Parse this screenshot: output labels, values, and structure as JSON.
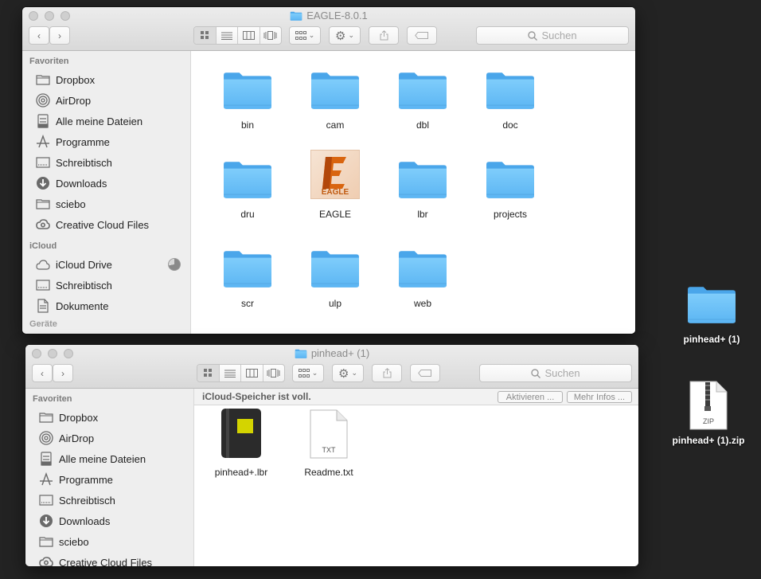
{
  "window1": {
    "title": "EAGLE-8.0.1",
    "search_placeholder": "Suchen",
    "sidebar": {
      "favorites_header": "Favoriten",
      "favorites": [
        "Dropbox",
        "AirDrop",
        "Alle meine Dateien",
        "Programme",
        "Schreibtisch",
        "Downloads",
        "sciebo",
        "Creative Cloud Files"
      ],
      "icloud_header": "iCloud",
      "icloud": [
        "iCloud Drive",
        "Schreibtisch",
        "Dokumente"
      ],
      "devices_header": "Geräte"
    },
    "items": [
      "bin",
      "cam",
      "dbl",
      "doc",
      "dru",
      "EAGLE",
      "lbr",
      "projects",
      "scr",
      "ulp",
      "web"
    ],
    "app_icon_text": "EAGLE"
  },
  "window2": {
    "title": "pinhead+ (1)",
    "search_placeholder": "Suchen",
    "banner": {
      "text": "iCloud-Speicher ist voll.",
      "activate": "Aktivieren ...",
      "more": "Mehr Infos ..."
    },
    "sidebar": {
      "favorites_header": "Favoriten",
      "favorites": [
        "Dropbox",
        "AirDrop",
        "Alle meine Dateien",
        "Programme",
        "Schreibtisch",
        "Downloads",
        "sciebo",
        "Creative Cloud Files"
      ]
    },
    "items": [
      "pinhead+.lbr",
      "Readme.txt"
    ],
    "txt_icon_text": "TXT"
  },
  "desktop": {
    "folder": "pinhead+ (1)",
    "zip": "pinhead+ (1).zip",
    "zip_icon_text": "ZIP"
  },
  "colors": {
    "folder": "#6cc1f7",
    "desktop_bg": "#232323",
    "sidebar_bg": "#eeeeee"
  }
}
